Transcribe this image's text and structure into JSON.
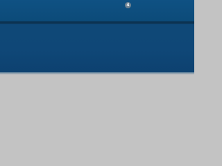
{
  "header": {
    "notification_badge": "4"
  },
  "colors": {
    "header_blue": "#0f5183",
    "panel_blue": "#0f4877",
    "content_gray": "#c3c3c3",
    "badge_gray": "#6f8292"
  }
}
